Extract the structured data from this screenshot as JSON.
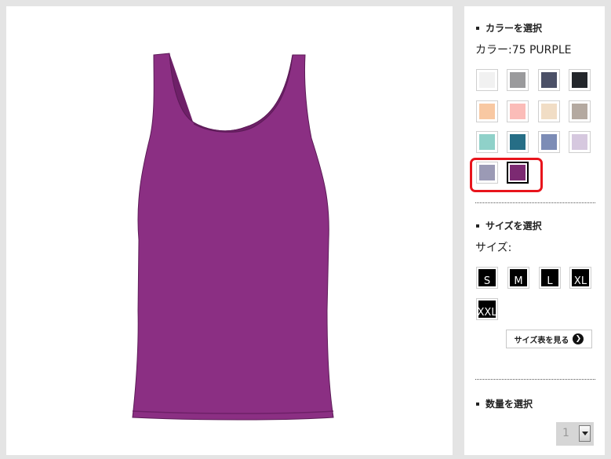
{
  "product": {
    "image_alt": "purple tank top",
    "color_hex": "#8b2f83",
    "shade_hex": "#6e2068"
  },
  "color_section": {
    "heading": "カラーを選択",
    "value_label": "カラー:",
    "value": "75 PURPLE",
    "swatches": [
      {
        "name": "white",
        "color": "#f1f1f1"
      },
      {
        "name": "gray",
        "color": "#9a9a9c"
      },
      {
        "name": "navy-slate",
        "color": "#4b5067"
      },
      {
        "name": "black",
        "color": "#23262b"
      },
      {
        "name": "peach",
        "color": "#f8c8a2"
      },
      {
        "name": "pink",
        "color": "#fbbcb8"
      },
      {
        "name": "beige",
        "color": "#f1ddc5"
      },
      {
        "name": "taupe",
        "color": "#b4a9a0"
      },
      {
        "name": "mint",
        "color": "#8fd1c9"
      },
      {
        "name": "teal",
        "color": "#266e86"
      },
      {
        "name": "periwinkle",
        "color": "#7c8cb6"
      },
      {
        "name": "lavender",
        "color": "#d6c8df"
      },
      {
        "name": "lilac-gray",
        "color": "#9b9ab5"
      },
      {
        "name": "purple",
        "color": "#7c2a72"
      }
    ],
    "selected_index": 13
  },
  "size_section": {
    "heading": "サイズを選択",
    "value_label": "サイズ:",
    "sizes": [
      "S",
      "M",
      "L",
      "XL",
      "XXL"
    ],
    "size_chart_label": "サイズ表を見る",
    "size_chart_icon": "chevron-right-icon"
  },
  "quantity_section": {
    "heading": "数量を選択",
    "value": "1"
  }
}
